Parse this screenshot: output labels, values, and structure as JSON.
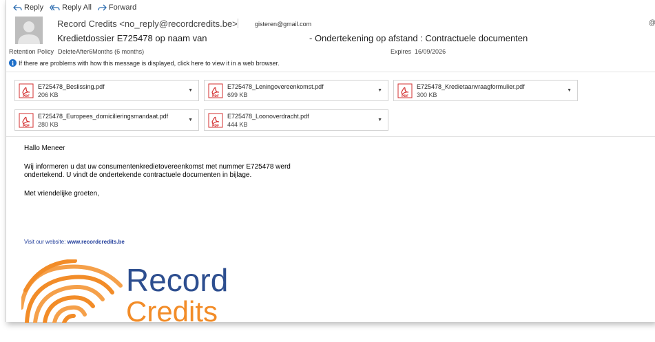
{
  "toolbar": {
    "reply": "Reply",
    "reply_all": "Reply All",
    "forward": "Forward"
  },
  "header": {
    "from": "Record Credits <no_reply@recordcredits.be>",
    "to": "gisteren@gmail.com",
    "subject_part1": "Kredietdossier E725478 op naam van",
    "subject_part2": "- Ondertekening op afstand : Contractuele documenten",
    "retention_label": "Retention Policy",
    "retention_value": "DeleteAfter6Months (6 months)",
    "expires_label": "Expires",
    "expires_value": "16/09/2026",
    "info_text": "If there are problems with how this message is displayed, click here to view it in a web browser."
  },
  "attachments": [
    {
      "name": "E725478_Beslissing.pdf",
      "size": "206 KB"
    },
    {
      "name": "E725478_Leningovereenkomst.pdf",
      "size": "699 KB"
    },
    {
      "name": "E725478_Kredietaanvraagformulier.pdf",
      "size": "300 KB"
    },
    {
      "name": "E725478_Europees_domicilieringsmandaat.pdf",
      "size": "280 KB"
    },
    {
      "name": "E725478_Loonoverdracht.pdf",
      "size": "444 KB"
    }
  ],
  "body": {
    "greeting": "Hallo Meneer",
    "line1": "Wij informeren u dat uw consumentenkredietovereenkomst met nummer E725478 werd",
    "line2": "ondertekend. U vindt de ondertekende contractuele documenten in bijlage.",
    "closing": "Met vriendelijke groeten,",
    "visit_label": "Visit our website:",
    "visit_url": "www.recordcredits.be"
  },
  "logo": {
    "word1": "Record",
    "word2": "Credits",
    "color_blue": "#2d4e8f",
    "color_orange": "#f28c28"
  },
  "colors": {
    "pdf_red": "#d32f2f",
    "info_blue": "#1e6fc9",
    "link_blue": "#1f3c9a"
  }
}
